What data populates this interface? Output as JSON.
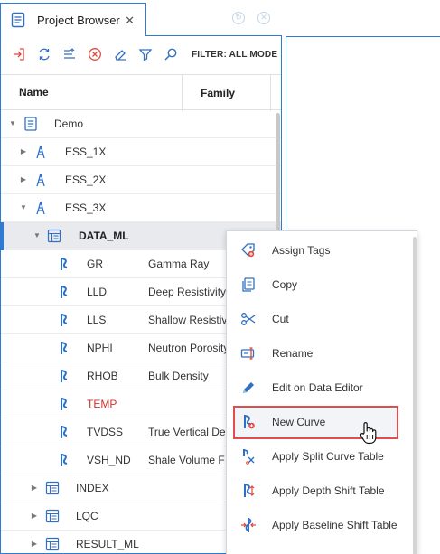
{
  "tab": {
    "title": "Project Browser",
    "close": "✕"
  },
  "window": {
    "restore": "↻",
    "close": "✕"
  },
  "toolbar": {
    "filter_label": "FILTER: ALL MODE"
  },
  "columns": {
    "name": "Name",
    "family": "Family"
  },
  "tree": {
    "demo": "Demo",
    "ess1": "ESS_1X",
    "ess2": "ESS_2X",
    "ess3": "ESS_3X",
    "dataml": "DATA_ML",
    "curves": [
      {
        "name": "GR",
        "family": "Gamma Ray"
      },
      {
        "name": "LLD",
        "family": "Deep Resistivity"
      },
      {
        "name": "LLS",
        "family": "Shallow Resistivity"
      },
      {
        "name": "NPHI",
        "family": "Neutron Porosity"
      },
      {
        "name": "RHOB",
        "family": "Bulk Density"
      },
      {
        "name": "TEMP",
        "family": ""
      },
      {
        "name": "TVDSS",
        "family": "True Vertical Depth"
      },
      {
        "name": "VSH_ND",
        "family": "Shale Volume F"
      }
    ],
    "index": "INDEX",
    "lqc": "LQC",
    "result": "RESULT_ML"
  },
  "context_menu": {
    "items": [
      "Assign Tags",
      "Copy",
      "Cut",
      "Rename",
      "Edit on Data Editor",
      "New Curve",
      "Apply Split Curve Table",
      "Apply Depth Shift Table",
      "Apply Baseline Shift Table"
    ],
    "highlighted": "New Curve"
  },
  "colors": {
    "accent": "#2f7bd2",
    "highlight_border": "#e14c4c",
    "curve_icon": "#2f6fc4",
    "error_text": "#d0312d"
  }
}
